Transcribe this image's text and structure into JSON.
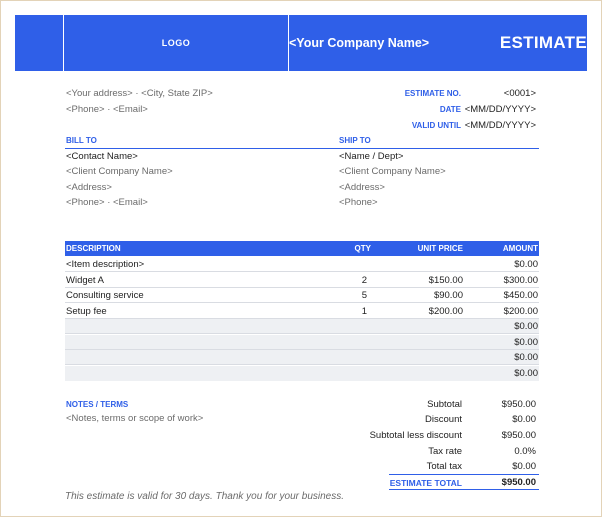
{
  "header": {
    "logo_label": "LOGO",
    "company_name": "<Your Company Name>",
    "doc_title": "ESTIMATE"
  },
  "sender": {
    "address_line": "<Your address>  ·  <City, State ZIP>",
    "contact_line": "<Phone>  ·  <Email>"
  },
  "meta": {
    "estimate_no_label": "ESTIMATE NO.",
    "estimate_no_value": "<0001>",
    "date_label": "DATE",
    "date_value": "<MM/DD/YYYY>",
    "valid_until_label": "VALID UNTIL",
    "valid_until_value": "<MM/DD/YYYY>"
  },
  "bill_to": {
    "heading": "BILL TO",
    "contact_name": "<Contact Name>",
    "company": "<Client Company Name>",
    "address": "<Address>",
    "contact_line": "<Phone>  ·  <Email>"
  },
  "ship_to": {
    "heading": "SHIP TO",
    "name": "<Name / Dept>",
    "company": "<Client Company Name>",
    "address": "<Address>",
    "phone": "<Phone>"
  },
  "table": {
    "columns": {
      "description": "DESCRIPTION",
      "qty": "QTY",
      "unit_price": "UNIT PRICE",
      "amount": "AMOUNT"
    },
    "rows": [
      {
        "description": "<Item description>",
        "qty": "",
        "unit_price": "",
        "amount": "$0.00"
      },
      {
        "description": "Widget A",
        "qty": "2",
        "unit_price": "$150.00",
        "amount": "$300.00"
      },
      {
        "description": "Consulting service",
        "qty": "5",
        "unit_price": "$90.00",
        "amount": "$450.00"
      },
      {
        "description": "Setup fee",
        "qty": "1",
        "unit_price": "$200.00",
        "amount": "$200.00"
      },
      {
        "description": "",
        "qty": "",
        "unit_price": "",
        "amount": "$0.00"
      },
      {
        "description": "",
        "qty": "",
        "unit_price": "",
        "amount": "$0.00"
      },
      {
        "description": "",
        "qty": "",
        "unit_price": "",
        "amount": "$0.00"
      },
      {
        "description": "",
        "qty": "",
        "unit_price": "",
        "amount": "$0.00"
      }
    ]
  },
  "notes": {
    "heading": "NOTES / TERMS",
    "text": "<Notes, terms or scope of work>"
  },
  "totals": {
    "subtotal_label": "Subtotal",
    "subtotal_value": "$950.00",
    "discount_label": "Discount",
    "discount_value": "$0.00",
    "subtotal_less_discount_label": "Subtotal less discount",
    "subtotal_less_discount_value": "$950.00",
    "tax_rate_label": "Tax rate",
    "tax_rate_value": "0.0%",
    "total_tax_label": "Total tax",
    "total_tax_value": "$0.00",
    "estimate_total_label": "ESTIMATE TOTAL",
    "estimate_total_value": "$950.00"
  },
  "footer": {
    "note": "This estimate is valid for 30 days.  Thank you for your business."
  },
  "colors": {
    "accent": "#2f5fe8",
    "row_shade": "#eef0f3",
    "muted_text": "#6b6b6b"
  }
}
